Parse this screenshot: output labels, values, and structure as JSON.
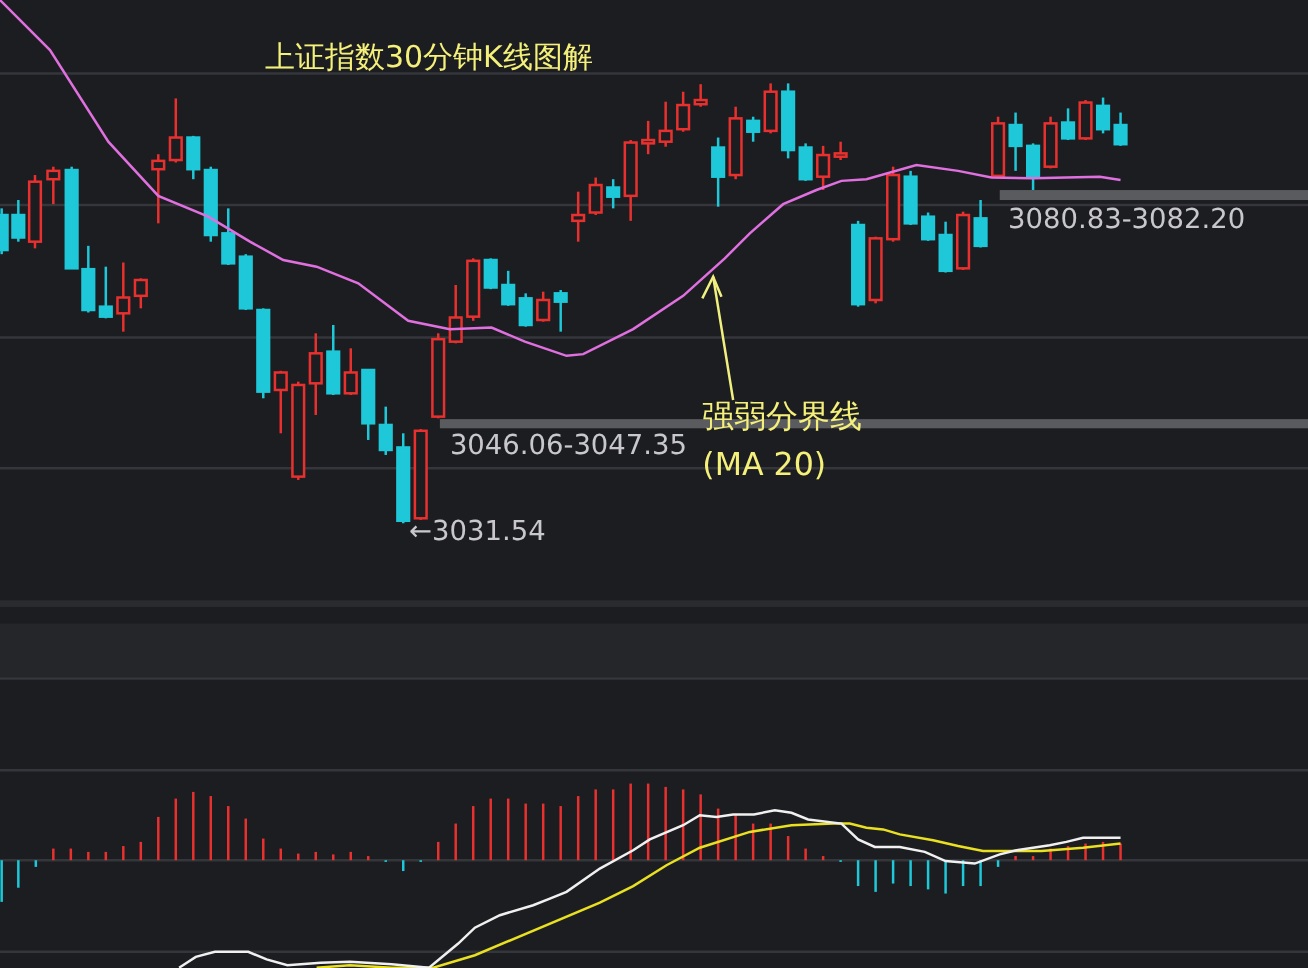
{
  "chart_title": "上证指数30分钟K线图解",
  "price_levels": [
    {
      "label": "3080.83-3082.20"
    },
    {
      "label": "3046.06-3047.35"
    }
  ],
  "low_label": "←3031.54",
  "ma_callout": {
    "line_1": "强弱分界线",
    "line_2": "(MA 20)"
  }
}
